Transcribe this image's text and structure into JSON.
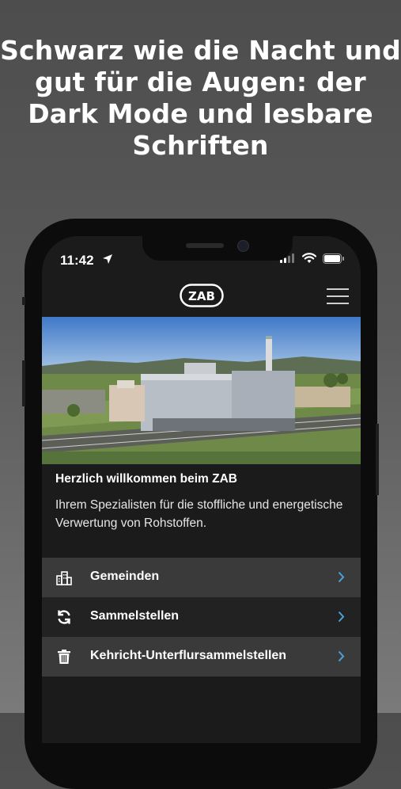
{
  "headline": "Schwarz wie die Nacht und gut für die Augen: der Dark Mode und lesbare Schriften",
  "status_bar": {
    "time": "11:42",
    "icons": [
      "location-arrow-icon",
      "signal-icon",
      "wifi-icon",
      "battery-icon"
    ]
  },
  "app": {
    "logo_text": "ZAB",
    "menu_icon": "hamburger-menu-icon"
  },
  "intro": {
    "title": "Herzlich willkommen beim ZAB",
    "text": "Ihrem Spezialisten für die stoffliche und energetische Verwertung von Rohstoffen."
  },
  "nav_items": [
    {
      "label": "Gemeinden",
      "icon": "buildings-icon"
    },
    {
      "label": "Sammelstellen",
      "icon": "recycle-arrows-icon"
    },
    {
      "label": "Kehricht-Unterflursammelstellen",
      "icon": "trash-can-icon"
    }
  ],
  "colors": {
    "accent_chevron": "#4aa3d9",
    "screen_bg": "#1b1b1b",
    "row_light": "#3a3a3a",
    "row_dark": "#222222"
  }
}
